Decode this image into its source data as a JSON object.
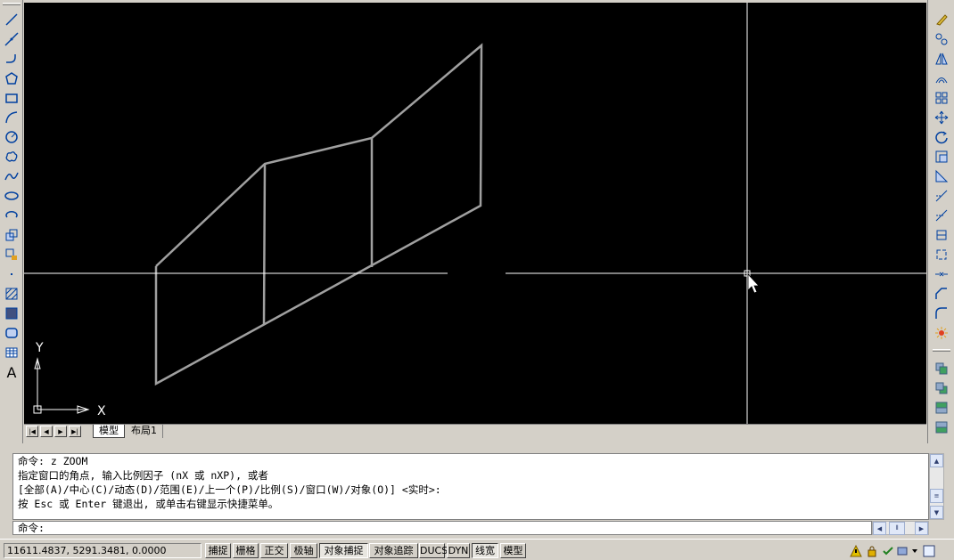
{
  "icons_left": [
    "line-icon",
    "xline-icon",
    "polyline-icon",
    "polygon-icon",
    "rectangle-icon",
    "arc-icon",
    "circle-icon",
    "revcloud-icon",
    "spline-icon",
    "ellipse-icon",
    "ellipse-arc-icon",
    "insert-block-icon",
    "make-block-icon",
    "point-icon",
    "hatch-icon",
    "gradient-icon",
    "region-icon",
    "table-icon",
    "mtext-icon"
  ],
  "icons_right": [
    "erase-icon",
    "copy-icon",
    "mirror-icon",
    "offset-icon",
    "array-icon",
    "move-icon",
    "rotate-icon",
    "scale-icon",
    "stretch-icon",
    "trim-icon",
    "extend-icon",
    "break-at-point-icon",
    "break-icon",
    "join-icon",
    "chamfer-icon",
    "fillet-icon",
    "explode-icon",
    "draworder-front-icon",
    "draworder-back-icon",
    "draworder-above-icon",
    "draworder-under-icon"
  ],
  "mtext_glyph": "A",
  "ucs": {
    "x_label": "X",
    "y_label": "Y"
  },
  "tabs": {
    "model": "模型",
    "layout1": "布局1"
  },
  "command": {
    "history": [
      "命令: z ZOOM",
      "指定窗口的角点, 输入比例因子 (nX 或 nXP), 或者",
      "[全部(A)/中心(C)/动态(D)/范围(E)/上一个(P)/比例(S)/窗口(W)/对象(O)] <实时>:",
      "按 Esc 或 Enter 键退出, 或单击右键显示快捷菜单。"
    ],
    "prompt": "命令:"
  },
  "status": {
    "coords": "11611.4837, 5291.3481, 0.0000",
    "buttons": [
      {
        "label": "捕捉",
        "on": false
      },
      {
        "label": "栅格",
        "on": false
      },
      {
        "label": "正交",
        "on": false
      },
      {
        "label": "极轴",
        "on": false
      },
      {
        "label": "对象捕捉",
        "on": true
      },
      {
        "label": "对象追踪",
        "on": false
      },
      {
        "label": "DUCS",
        "on": false
      },
      {
        "label": "DYN",
        "on": false
      },
      {
        "label": "线宽",
        "on": true
      },
      {
        "label": "模型",
        "on": false
      }
    ]
  },
  "colors": {
    "canvas": "#000000",
    "geometry": "#a0a0a0",
    "crosshair": "#ffffff"
  }
}
